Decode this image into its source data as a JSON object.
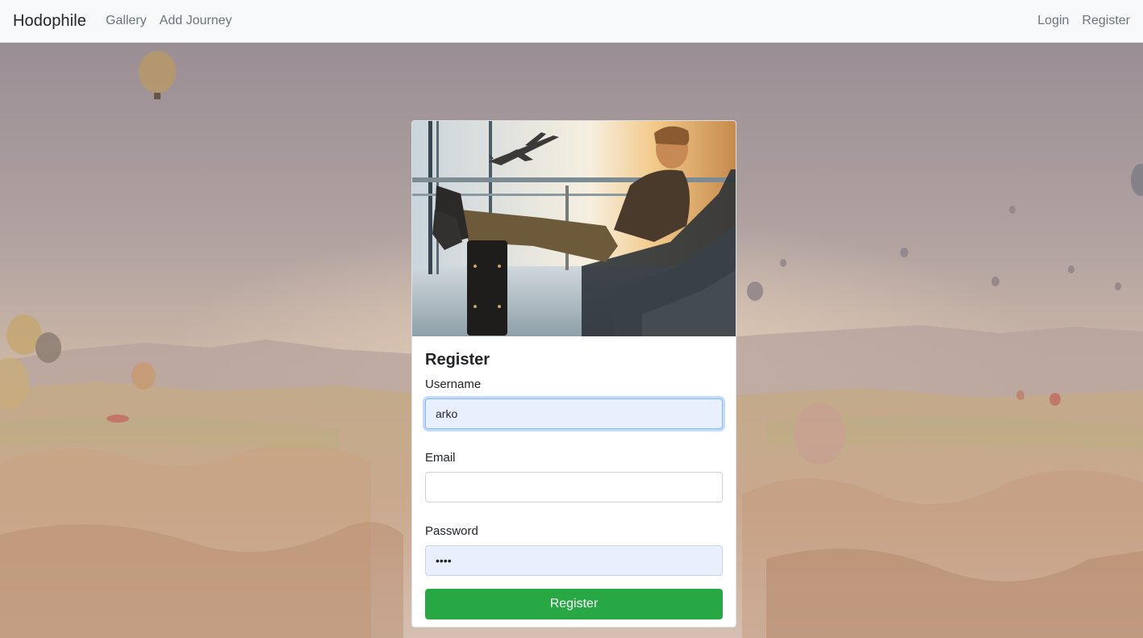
{
  "nav": {
    "brand": "Hodophile",
    "links": [
      "Gallery",
      "Add Journey"
    ],
    "right_links": [
      "Login",
      "Register"
    ]
  },
  "hero_image": {
    "alt": "traveler-at-airport"
  },
  "form": {
    "title": "Register",
    "username_label": "Username",
    "username_value": "arko",
    "email_label": "Email",
    "email_value": "",
    "password_label": "Password",
    "password_value": "pass",
    "submit_label": "Register"
  },
  "colors": {
    "navbar_bg": "#f8f9fa",
    "button_bg": "#28a745",
    "autofill_bg": "#e8f0fe",
    "focus_border": "#86b7fe"
  }
}
